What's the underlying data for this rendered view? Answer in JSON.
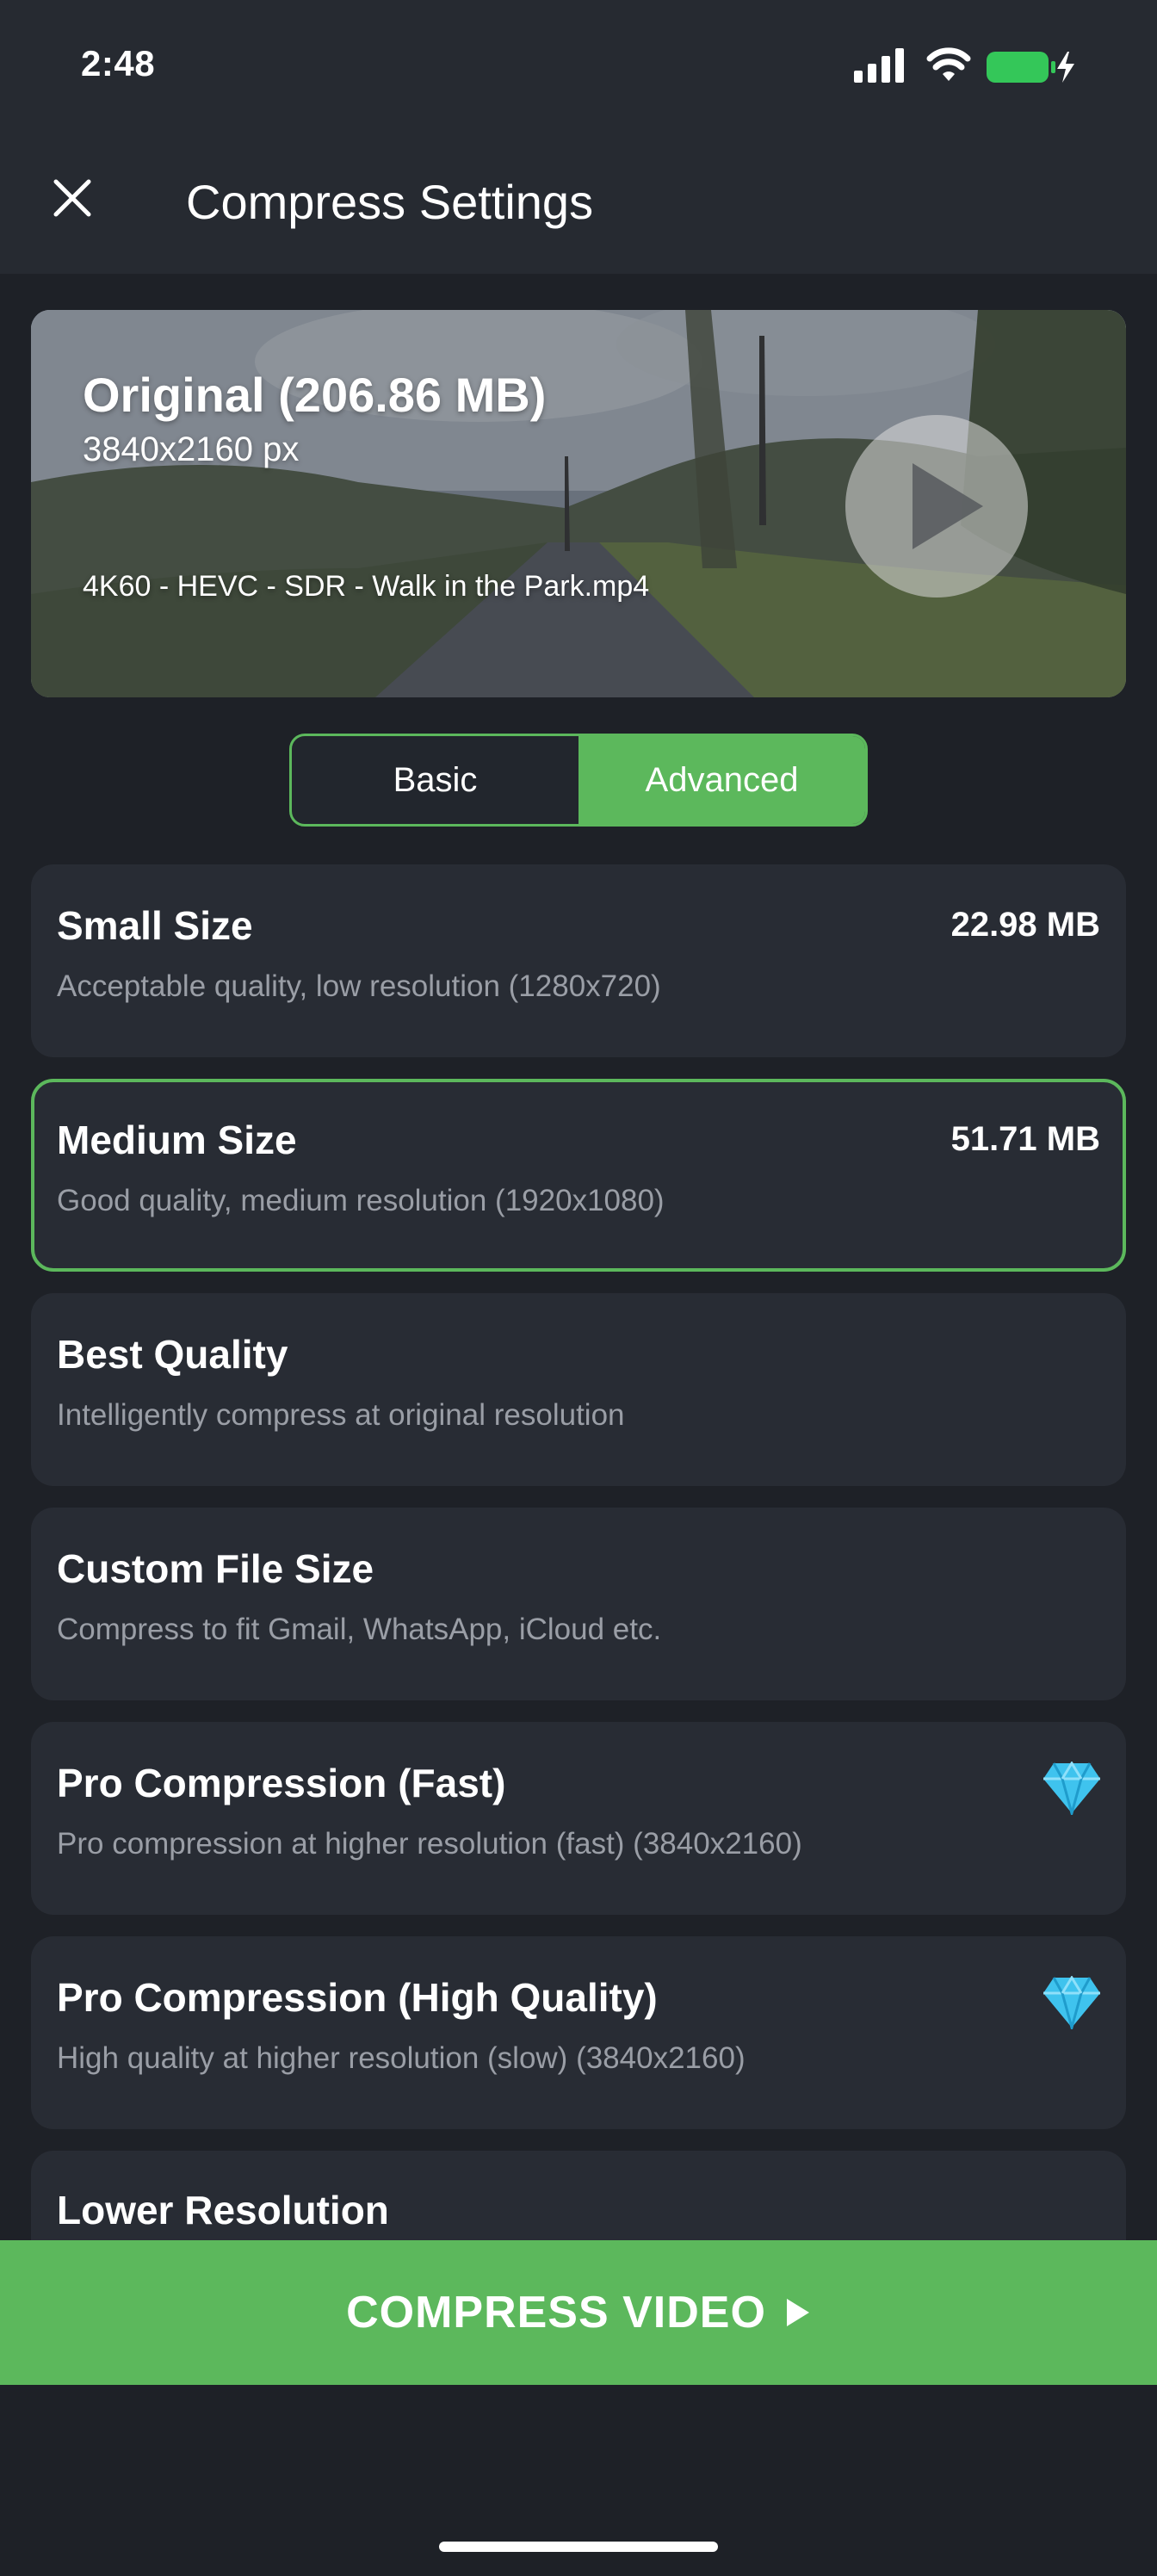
{
  "status_bar": {
    "time": "2:48",
    "icons": [
      "signal-icon",
      "wifi-icon",
      "battery-charging-icon"
    ],
    "battery_color": "#34c759"
  },
  "header": {
    "close_icon": "close-icon",
    "title": "Compress Settings"
  },
  "preview": {
    "title": "Original (206.86 MB)",
    "resolution": "3840x2160 px",
    "filename": "4K60 - HEVC - SDR - Walk in the Park.mp4",
    "play_icon": "play-icon"
  },
  "mode_tabs": {
    "items": [
      {
        "label": "Basic",
        "active": false
      },
      {
        "label": "Advanced",
        "active": true
      }
    ]
  },
  "options": [
    {
      "title": "Small Size",
      "description": "Acceptable quality, low resolution (1280x720)",
      "size": "22.98 MB",
      "selected": false
    },
    {
      "title": "Medium Size",
      "description": "Good quality, medium resolution (1920x1080)",
      "size": "51.71 MB",
      "selected": true
    },
    {
      "title": "Best Quality",
      "description": "Intelligently compress at original resolution",
      "selected": false
    },
    {
      "title": "Custom File Size",
      "description": "Compress to fit Gmail, WhatsApp, iCloud etc.",
      "selected": false
    },
    {
      "title": "Pro Compression (Fast)",
      "description": "Pro compression at higher resolution (fast) (3840x2160)",
      "pro_icon": "diamond-icon",
      "selected": false
    },
    {
      "title": "Pro Compression (High Quality)",
      "description": "High quality at higher resolution (slow) (3840x2160)",
      "pro_icon": "diamond-icon",
      "selected": false
    },
    {
      "title": "Lower Resolution",
      "selected": false
    }
  ],
  "compress_button": {
    "label": "COMPRESS VIDEO",
    "icon": "play-arrow-icon"
  },
  "colors": {
    "accent": "#5cb85c",
    "background": "#1e2127",
    "card": "#282c34",
    "header": "#262a31",
    "secondary_text": "#9a9ea6",
    "diamond": "#3fc3ee"
  }
}
